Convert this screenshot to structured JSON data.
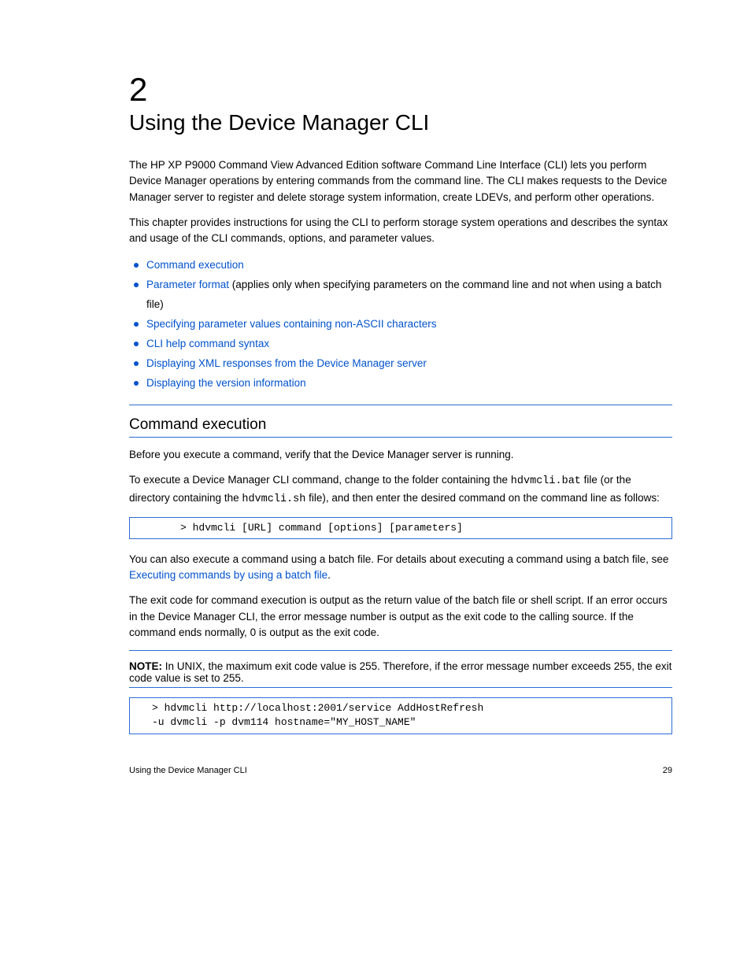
{
  "chapter_num": "2",
  "chapter_title": "Using the Device Manager CLI",
  "intro_p1": "The HP XP P9000 Command View Advanced Edition software Command Line Interface (CLI) lets you perform Device Manager operations by entering commands from the command line. The CLI makes requests to the Device Manager server to register and delete storage system information, create LDEVs, and perform other operations.",
  "intro_p2": "This chapter provides instructions for using the CLI to perform storage system operations and describes the syntax and usage of the CLI commands, options, and parameter values.",
  "toc_items": [
    {
      "label": "Command execution"
    },
    {
      "label": "Parameter format",
      "suffix_plain": " (applies only when specifying parameters on the command line and not when using a batch file)"
    },
    {
      "label": "Specifying parameter values containing non-ASCII characters"
    },
    {
      "label": "CLI help command syntax"
    },
    {
      "label": "Displaying XML responses from the Device Manager server"
    },
    {
      "label": "Displaying the version information"
    }
  ],
  "section1_title": "Command execution",
  "section1_p1": "Before you execute a command, verify that the Device Manager server is running.",
  "section1_p2_a": "To execute a Device Manager CLI command, change to the folder containing the ",
  "section1_p2_mono": "hdvmcli.bat",
  "section1_p2_b": " file (or the directory containing the ",
  "section1_p2_mono2": "hdvmcli.sh",
  "section1_p2_c": " file), and then enter the desired command on the command line as follows:",
  "codebox1": "> hdvmcli [URL] command [options] [parameters]",
  "section1_p3": "You can also execute a command using a batch file. For details about executing a command using a batch file, see ",
  "section1_p3_link": "Executing commands by using a batch file",
  "section1_p3_b": ".",
  "section1_p4": "The exit code for command execution is output as the return value of the batch file or shell script. If an error occurs in the Device Manager CLI, the error message number is output as the exit code to the calling source. If the command ends normally, 0 is output as the exit code.",
  "note_label": "NOTE:",
  "note_text": "In UNIX, the maximum exit code value is 255. Therefore, if the error message number exceeds 255, the exit code value is set to 255.",
  "codebox2_l1": "> hdvmcli http://localhost:2001/service AddHostRefresh",
  "codebox2_l2": "-u dvmcli -p dvm114 hostname=\"MY_HOST_NAME\"",
  "footer_left": "Using the Device Manager CLI",
  "footer_right": "29"
}
